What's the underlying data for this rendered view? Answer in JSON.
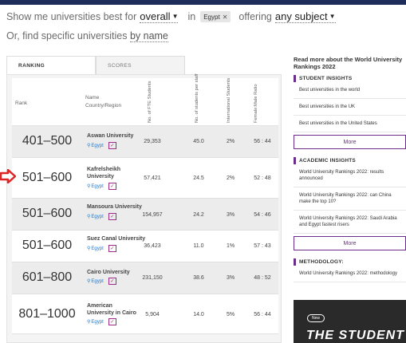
{
  "filters": {
    "prefix": "Show me universities best for",
    "metric": "overall",
    "in_word": "in",
    "country_chip": "Egypt",
    "offering_word": "offering",
    "subject": "any subject"
  },
  "find": {
    "prefix": "Or, find specific universities",
    "link": "by name"
  },
  "tabs": [
    {
      "label": "RANKING"
    },
    {
      "label": "SCORES"
    }
  ],
  "table": {
    "headers": {
      "rank": "Rank",
      "name_line1": "Name",
      "name_line2": "Country/Region",
      "fte": "No. of FTE Students",
      "ratio": "No. of students per staff",
      "intl": "International Students",
      "gender": "Female:Male Ratio"
    },
    "rows": [
      {
        "rank": "401–500",
        "name": "Aswan University",
        "country": "Egypt",
        "fte": "29,353",
        "ratio": "45.0",
        "intl": "2%",
        "gender": "56 : 44"
      },
      {
        "rank": "501–600",
        "name": "Kafrelsheikh University",
        "country": "Egypt",
        "fte": "57,421",
        "ratio": "24.5",
        "intl": "2%",
        "gender": "52 : 48"
      },
      {
        "rank": "501–600",
        "name": "Mansoura University",
        "country": "Egypt",
        "fte": "154,957",
        "ratio": "24.2",
        "intl": "3%",
        "gender": "54 : 46"
      },
      {
        "rank": "501–600",
        "name": "Suez Canal University",
        "country": "Egypt",
        "fte": "36,423",
        "ratio": "11.0",
        "intl": "1%",
        "gender": "57 : 43"
      },
      {
        "rank": "601–800",
        "name": "Cairo University",
        "country": "Egypt",
        "fte": "231,150",
        "ratio": "38.6",
        "intl": "3%",
        "gender": "48 : 52"
      },
      {
        "rank": "801–1000",
        "name": "American University in Cairo",
        "country": "Egypt",
        "fte": "5,904",
        "ratio": "14.0",
        "intl": "5%",
        "gender": "56 : 44"
      }
    ]
  },
  "sidebar": {
    "read_more": "Read more about the World University Rankings 2022",
    "student_insights": {
      "title": "STUDENT INSIGHTS",
      "items": [
        "Best universities in the world",
        "Best universities in the UK",
        "Best universities in the United States"
      ],
      "more": "More"
    },
    "academic_insights": {
      "title": "ACADEMIC INSIGHTS",
      "items": [
        "World University Rankings 2022: results announced",
        "World University Rankings 2022: can China make the top 10?",
        "World University Rankings 2022: Saudi Arabia and Egypt fastest risers"
      ],
      "more": "More"
    },
    "methodology": {
      "title": "METHODOLOGY:",
      "items": [
        "World University Rankings 2022: methodology"
      ]
    },
    "promo": {
      "badge": "New",
      "word": "THE STUDENT"
    }
  },
  "colors": {
    "accent": "#6b2d8b",
    "link": "#1a7ad6",
    "topbar": "#1e2d5a",
    "arrow": "#e02424"
  }
}
